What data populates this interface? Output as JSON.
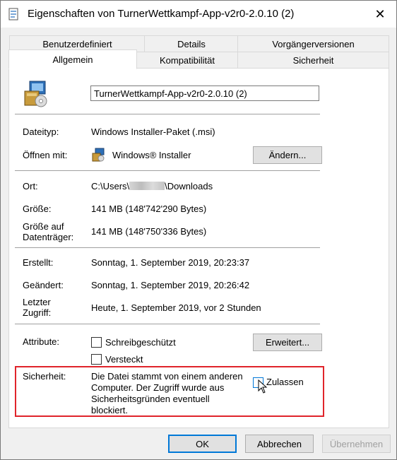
{
  "window": {
    "title": "Eigenschaften von TurnerWettkampf-App-v2r0-2.0.10 (2)",
    "close_glyph": "✕"
  },
  "tabs": {
    "row1": [
      "Benutzerdefiniert",
      "Details",
      "Vorgängerversionen"
    ],
    "row2": [
      "Allgemein",
      "Kompatibilität",
      "Sicherheit"
    ]
  },
  "general": {
    "file_name": "TurnerWettkampf-App-v2r0-2.0.10 (2)",
    "type_label": "Dateityp:",
    "type_value": "Windows Installer-Paket (.msi)",
    "open_with_label": "Öffnen mit:",
    "open_with_value": "Windows® Installer",
    "change_button": "Ändern...",
    "location_label": "Ort:",
    "location_prefix": "C:\\Users\\",
    "location_suffix": "\\Downloads",
    "size_label": "Größe:",
    "size_value": "141 MB (148'742'290 Bytes)",
    "disk_size_label_1": "Größe auf",
    "disk_size_label_2": "Datenträger:",
    "disk_size_value": "141 MB (148'750'336 Bytes)",
    "created_label": "Erstellt:",
    "created_value": "Sonntag, 1. September 2019, 20:23:37",
    "modified_label": "Geändert:",
    "modified_value": "Sonntag, 1. September 2019, 20:26:42",
    "accessed_label_1": "Letzter",
    "accessed_label_2": "Zugriff:",
    "accessed_value": "Heute, 1. September 2019, vor 2 Stunden",
    "attributes_label": "Attribute:",
    "readonly_label": "Schreibgeschützt",
    "hidden_label": "Versteckt",
    "advanced_button": "Erweitert...",
    "security_label": "Sicherheit:",
    "security_text_1": "Die Datei stammt von einem anderen",
    "security_text_2": "Computer. Der Zugriff wurde aus",
    "security_text_3": "Sicherheitsgründen eventuell",
    "security_text_4": "blockiert.",
    "unblock_label": "Zulassen"
  },
  "footer": {
    "ok": "OK",
    "cancel": "Abbrechen",
    "apply": "Übernehmen"
  },
  "colors": {
    "accent": "#0078d7",
    "highlight": "#e0242b"
  }
}
